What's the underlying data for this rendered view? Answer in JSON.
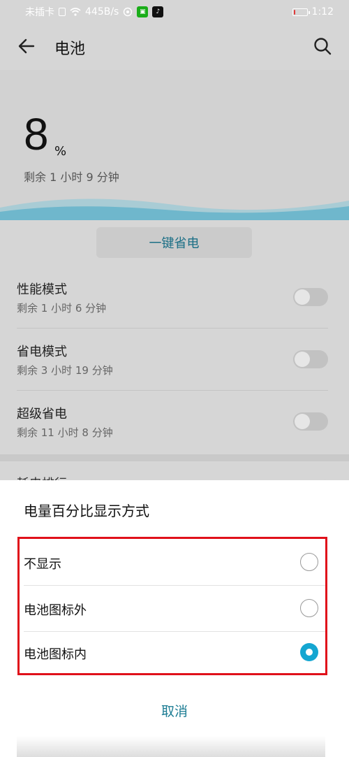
{
  "status_bar": {
    "carrier": "未插卡",
    "net_speed": "445B/s",
    "time": "1:12",
    "battery_level_fraction": 0.08,
    "icons": [
      "sim-icon",
      "wifi-icon",
      "vpn-icon",
      "wechat-icon",
      "tiktok-icon",
      "battery-icon"
    ]
  },
  "header": {
    "title": "电池",
    "back_icon": "arrow-left-icon",
    "search_icon": "search-icon"
  },
  "battery": {
    "percent": "8",
    "percent_sign": "%",
    "remaining": "剩余 1 小时 9 分钟",
    "wave_color": "#6fb7cc"
  },
  "one_key_save": "一键省电",
  "modes": [
    {
      "title": "性能模式",
      "sub": "剩余 1 小时 6 分钟",
      "on": false
    },
    {
      "title": "省电模式",
      "sub": "剩余 3 小时 19 分钟",
      "on": false
    },
    {
      "title": "超级省电",
      "sub": "剩余 11 小时 8 分钟",
      "on": false
    }
  ],
  "partial_row": {
    "text": "耗电排行",
    "chevron": "›"
  },
  "dialog": {
    "title": "电量百分比显示方式",
    "options": [
      {
        "label": "不显示",
        "selected": false
      },
      {
        "label": "电池图标外",
        "selected": false
      },
      {
        "label": "电池图标内",
        "selected": true
      }
    ],
    "cancel": "取消",
    "accent_color": "#14a6d1",
    "highlight_color": "#e0101a"
  }
}
